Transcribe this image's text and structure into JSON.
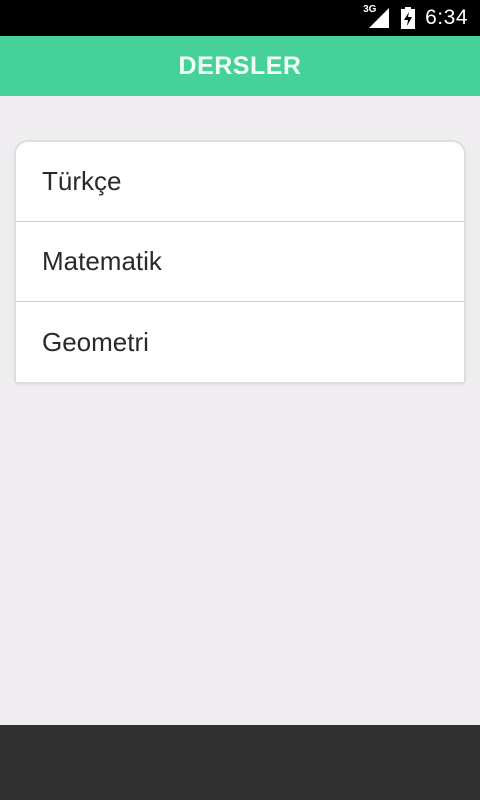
{
  "status_bar": {
    "network": "3G",
    "time": "6:34"
  },
  "header": {
    "title": "DERSLER"
  },
  "courses": [
    {
      "label": "Türkçe"
    },
    {
      "label": "Matematik"
    },
    {
      "label": "Geometri"
    }
  ],
  "colors": {
    "app_bar": "#45d199",
    "background": "#efedf0",
    "nav_bar": "#303030"
  }
}
